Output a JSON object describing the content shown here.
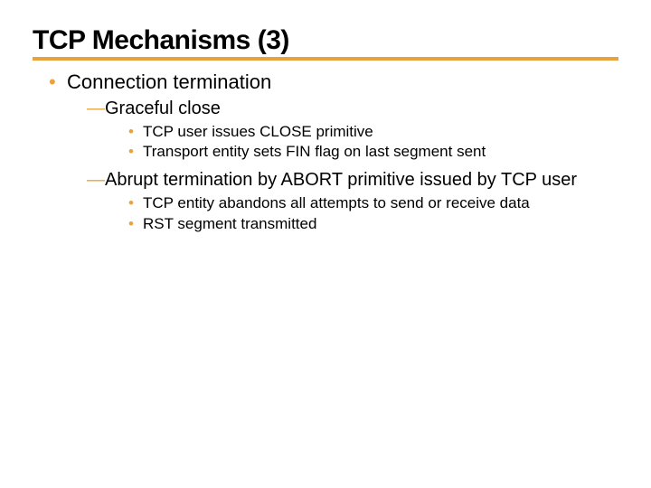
{
  "title": "TCP Mechanisms (3)",
  "bullets": {
    "b1": "Connection termination",
    "b1_1": "Graceful close",
    "b1_1_1": "TCP user issues CLOSE primitive",
    "b1_1_2": "Transport entity sets FIN flag on last segment sent",
    "b1_2": "Abrupt termination by ABORT primitive issued by TCP user",
    "b1_2_1": "TCP entity abandons all attempts to send or receive data",
    "b1_2_2": "RST segment transmitted"
  }
}
